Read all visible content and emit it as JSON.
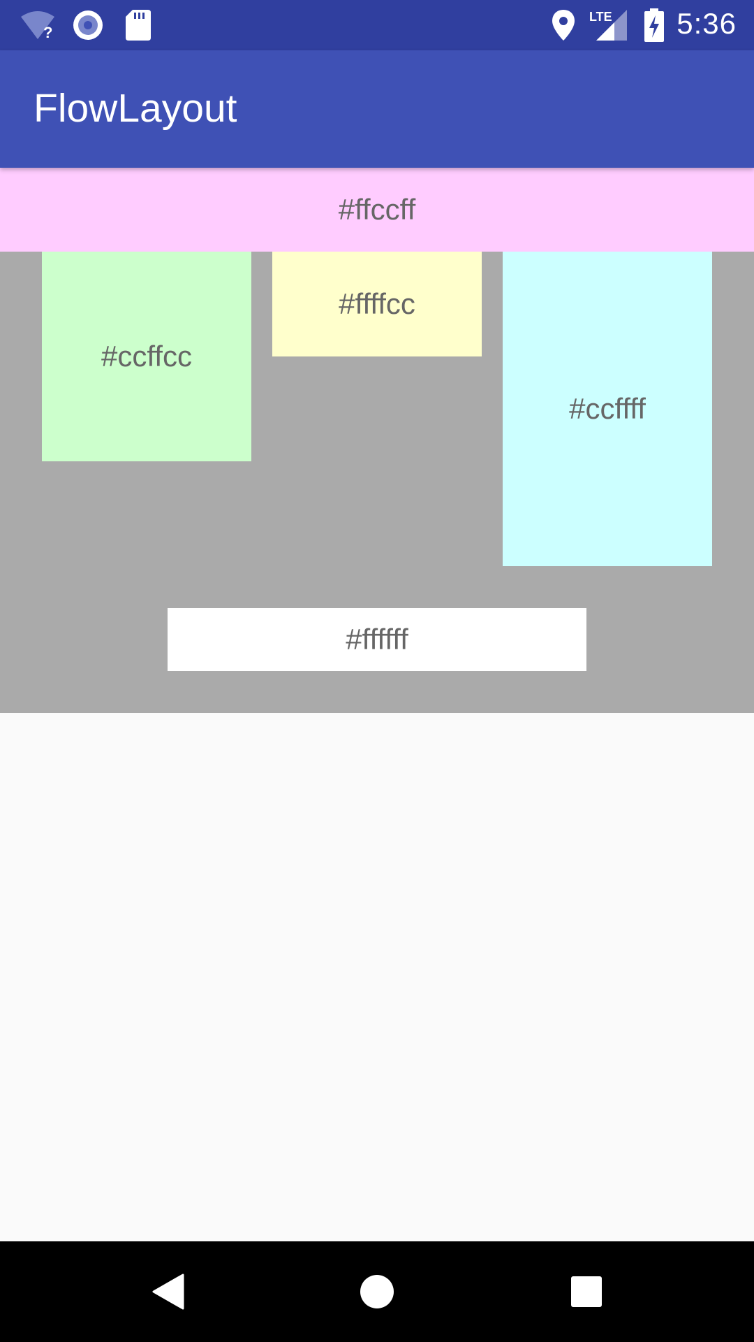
{
  "status_bar": {
    "time": "5:36",
    "network_label": "LTE",
    "icons": [
      "wifi-unknown-icon",
      "sync-circle-icon",
      "sd-card-icon",
      "location-pin-icon",
      "lte-signal-icon",
      "battery-charging-icon"
    ]
  },
  "app_bar": {
    "title": "FlowLayout"
  },
  "tiles": {
    "pink": {
      "label": "#ffccff",
      "color": "#ffccff"
    },
    "green": {
      "label": "#ccffcc",
      "color": "#ccffcc"
    },
    "yellow": {
      "label": "#ffffcc",
      "color": "#ffffcc"
    },
    "cyan": {
      "label": "#ccffff",
      "color": "#ccffff"
    },
    "white": {
      "label": "#ffffff",
      "color": "#ffffff"
    }
  },
  "colors": {
    "status_bar": "#303f9f",
    "app_bar": "#3f51b5",
    "container": "#aaaaaa",
    "background": "#fafafa",
    "nav_bar": "#000000"
  },
  "nav_bar": {
    "buttons": [
      "back-icon",
      "home-icon",
      "recents-icon"
    ]
  }
}
